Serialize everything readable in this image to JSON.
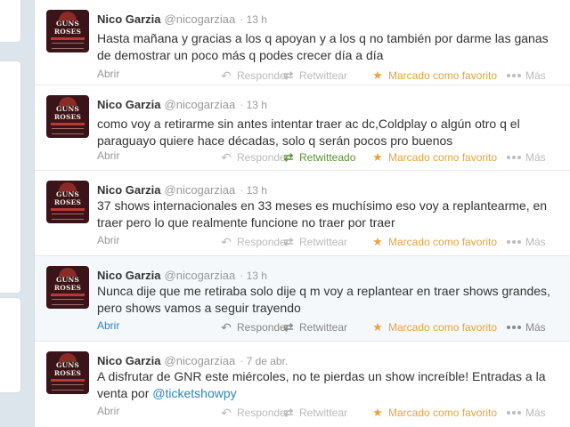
{
  "actions": {
    "reply": "Responder",
    "retweet": "Retwittear",
    "retweeted": "Retwitteado",
    "favorited": "Marcado como favorito",
    "more": "Más",
    "expand": "Abrir"
  },
  "colors": {
    "link": "#2a85c8",
    "favorite": "#e8a33d",
    "retweeted": "#5c913b"
  },
  "avatar": {
    "line1": "GUNS N' ROSES",
    "line2": ""
  },
  "tweets": [
    {
      "fullname": "Nico Garzia",
      "username": "@nicogarziaa",
      "separator": "·",
      "time": "13 h",
      "text": "Hasta mañana y gracias a los q apoyan y a los q no también por darme las ganas de demostrar un poco más q podes crecer día a día"
    },
    {
      "fullname": "Nico Garzia",
      "username": "@nicogarziaa",
      "separator": "·",
      "time": "13 h",
      "text": "como voy a retirarme sin antes intentar traer ac dc,Coldplay o algún otro q el paraguayo quiere hace décadas, solo q serán pocos pro buenos"
    },
    {
      "fullname": "Nico Garzia",
      "username": "@nicogarziaa",
      "separator": "·",
      "time": "13 h",
      "text": "37 shows internacionales en 33 meses es muchísimo eso voy a replantearme, en traer pero lo que realmente funcione no traer por traer"
    },
    {
      "fullname": "Nico Garzia",
      "username": "@nicogarziaa",
      "separator": "·",
      "time": "13 h",
      "text": "Nunca dije que me retiraba solo dije q m voy a replantear en traer shows grandes, pero shows vamos a seguir trayendo"
    },
    {
      "fullname": "Nico Garzia",
      "username": "@nicogarziaa",
      "separator": "·",
      "time": "7 de abr.",
      "text": "A disfrutar de GNR este miércoles, no te pierdas un show increíble! Entradas a la venta por ",
      "mention": "@ticketshowpy"
    }
  ]
}
